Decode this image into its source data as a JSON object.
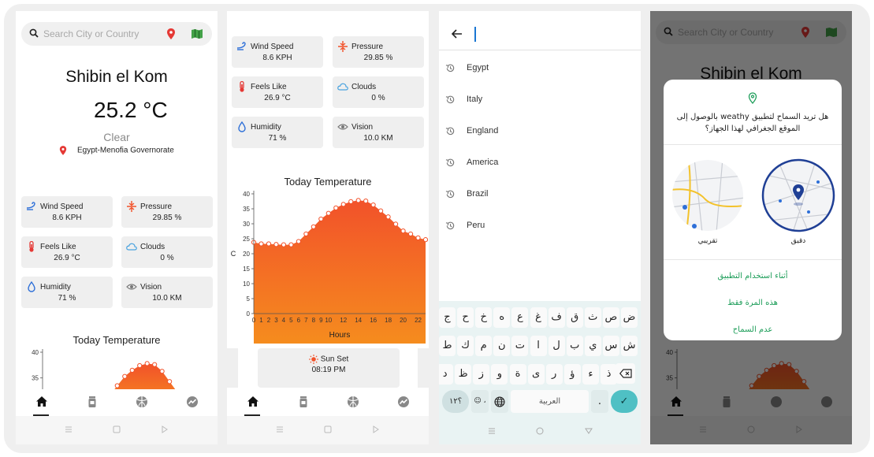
{
  "search": {
    "placeholder": "Search City or Country"
  },
  "weather": {
    "city": "Shibin el Kom",
    "temperature": "25.2 °C",
    "condition": "Clear",
    "location": "Egypt-Menofia Governorate"
  },
  "stats": [
    {
      "label": "Wind Speed",
      "value": "8.6 KPH",
      "icon": "wind-icon"
    },
    {
      "label": "Pressure",
      "value": "29.85 %",
      "icon": "pressure-icon"
    },
    {
      "label": "Feels Like",
      "value": "26.9 °C",
      "icon": "thermometer-icon"
    },
    {
      "label": "Clouds",
      "value": "0 %",
      "icon": "cloud-icon"
    },
    {
      "label": "Humidity",
      "value": "71 %",
      "icon": "drop-icon"
    },
    {
      "label": "Vision",
      "value": "10.0 KM",
      "icon": "eye-icon"
    }
  ],
  "sunset": {
    "label": "Sun Set",
    "time": "08:19 PM"
  },
  "chart_data": {
    "type": "area",
    "title": "Today Temperature",
    "xlabel": "Hours",
    "ylabel": "C",
    "ylim": [
      0,
      40
    ],
    "yticks": [
      0,
      5,
      10,
      15,
      20,
      25,
      30,
      35,
      40
    ],
    "xticks": [
      0,
      1,
      2,
      3,
      4,
      5,
      6,
      7,
      8,
      9,
      10,
      12,
      14,
      16,
      18,
      20,
      22
    ],
    "x": [
      0,
      1,
      2,
      3,
      4,
      5,
      6,
      7,
      8,
      9,
      10,
      11,
      12,
      13,
      14,
      15,
      16,
      17,
      18,
      19,
      20,
      21,
      22,
      23
    ],
    "values": [
      23.8,
      23.3,
      23.3,
      23.1,
      23.0,
      23.0,
      24.1,
      26.6,
      29.0,
      31.6,
      33.5,
      35.3,
      36.5,
      37.4,
      37.8,
      37.6,
      36.3,
      34.3,
      32.3,
      29.9,
      27.6,
      26.6,
      25.3,
      24.7
    ],
    "fill_top": "#f2522a",
    "fill_bottom": "#f58c1e"
  },
  "search_history": {
    "title": "",
    "items": [
      "Egypt",
      "Italy",
      "England",
      "America",
      "Brazil",
      "Peru"
    ]
  },
  "keyboard": {
    "rows": [
      [
        "ض",
        "ص",
        "ث",
        "ق",
        "ف",
        "غ",
        "ع",
        "ه",
        "خ",
        "ح",
        "ج"
      ],
      [
        "ش",
        "س",
        "ي",
        "ب",
        "ل",
        "ا",
        "ت",
        "ن",
        "م",
        "ك",
        "ط"
      ],
      [
        "ذ",
        "ء",
        "ؤ",
        "ر",
        "ى",
        "ة",
        "و",
        "ز",
        "ظ",
        "د"
      ]
    ],
    "numbers_key": "؟١٢",
    "emoji_key": "☺ ،",
    "space_label": "العربية",
    "period_key": ".",
    "enter_symbol": "✓"
  },
  "permission": {
    "question": "هل تريد السماح لتطبيق weathy بالوصول إلى الموقع الجغرافي لهذا الجهاز؟",
    "precise": "دقيق",
    "approximate": "تقريبي",
    "options": [
      "أثناء استخدام التطبيق",
      "هذه المرة فقط",
      "عدم السماح"
    ]
  },
  "colors": {
    "accent_green": "#1e9e5a",
    "location_red": "#e53935",
    "icon_blue": "#2d6fd8",
    "chart_orange": "#f2522a"
  }
}
